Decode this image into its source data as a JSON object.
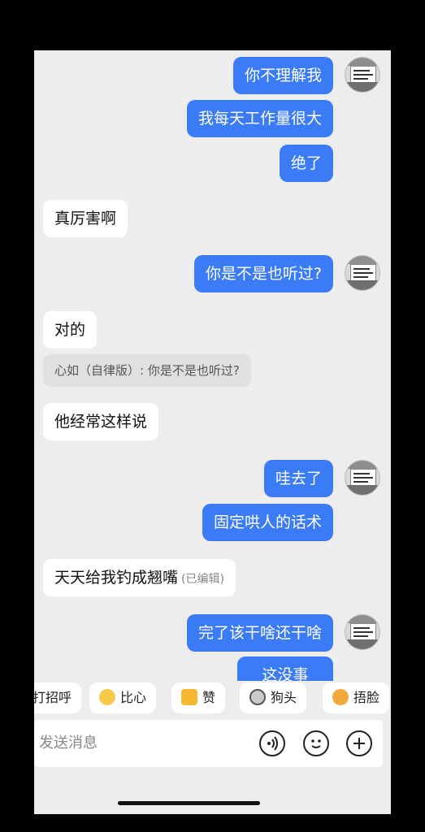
{
  "messages": [
    {
      "side": "out",
      "text": "你不理解我"
    },
    {
      "side": "out",
      "text": "我每天工作量很大"
    },
    {
      "side": "out",
      "text": "绝了"
    },
    {
      "side": "in",
      "text": "真厉害啊"
    },
    {
      "side": "out",
      "text": "你是不是也听过?"
    },
    {
      "side": "in",
      "text": "对的"
    },
    {
      "side": "quote",
      "text": "心如（自律版）: 你是不是也听过?"
    },
    {
      "side": "in",
      "text": "他经常这样说"
    },
    {
      "side": "out",
      "text": "哇去了"
    },
    {
      "side": "out",
      "text": "固定哄人的话术"
    },
    {
      "side": "in",
      "text": "天天给我钓成翘嘴",
      "edited": "(已编辑)"
    },
    {
      "side": "out",
      "text": "完了该干啥还干啥"
    },
    {
      "side": "out",
      "text": "这没事"
    }
  ],
  "quick_replies": [
    {
      "label": "打招呼",
      "icon": "wave-icon"
    },
    {
      "label": "比心",
      "icon": "heart-hand-icon"
    },
    {
      "label": "赞",
      "icon": "thumbs-up-icon"
    },
    {
      "label": "狗头",
      "icon": "dog-head-icon"
    },
    {
      "label": "捂脸",
      "icon": "facepalm-icon"
    }
  ],
  "input": {
    "placeholder": "发送消息"
  },
  "input_buttons": [
    "voice-icon",
    "emoji-icon",
    "plus-icon"
  ],
  "colors": {
    "outgoing_bubble": "#3b7bf5",
    "incoming_bubble": "#ffffff",
    "background": "#ededed"
  }
}
